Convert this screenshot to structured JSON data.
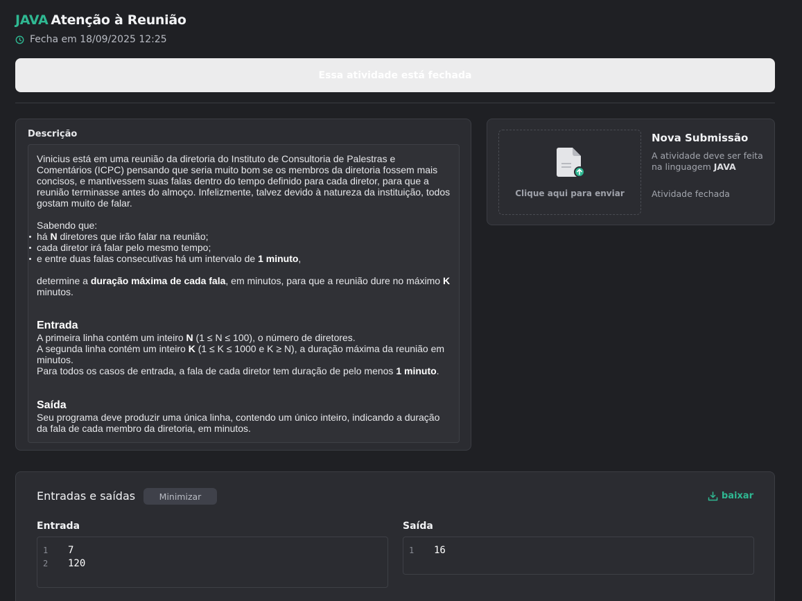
{
  "header": {
    "language": "JAVA",
    "title": "Atenção à Reunião",
    "deadline": "Fecha em 18/09/2025 12:25"
  },
  "closed_banner": "Essa atividade está fechada",
  "description": {
    "label": "Descrição",
    "intro": "Vinicius está em uma reunião da diretoria do Instituto de Consultoria de Palestras e Comentários (ICPC) pensando que seria muito bom se os membros da diretoria fossem mais concisos, e mantivessem suas falas dentro do tempo definido para cada diretor, para que a reunião terminasse antes do almoço. Infelizmente, talvez devido à natureza da instituição, todos gostam muito de falar.",
    "knowing": "Sabendo que:",
    "b1_pre": "há ",
    "b1_bold": "N",
    "b1_post": " diretores que irão falar na reunião;",
    "b2": "cada diretor irá falar pelo mesmo tempo;",
    "b3_pre": "e entre duas falas consecutivas há um intervalo de ",
    "b3_bold": "1 minuto",
    "b3_post": ",",
    "det_pre": "determine a ",
    "det_bold": "duração máxima de cada fala",
    "det_mid": ", em minutos, para que a reunião dure no máximo ",
    "det_bold2": "K",
    "det_post": " minutos.",
    "input_heading": "Entrada",
    "in1_pre": "A primeira linha contém um inteiro ",
    "in1_bold": "N",
    "in1_post": " (1 ≤ N ≤ 100), o número de diretores.",
    "in2_pre": "A segunda linha contém um inteiro ",
    "in2_bold": "K",
    "in2_post": " (1 ≤ K ≤ 1000 e K ≥ N), a duração máxima da reunião em minutos.",
    "in3_pre": "Para todos os casos de entrada, a fala de cada diretor tem duração de pelo menos ",
    "in3_bold": "1 minuto",
    "in3_post": ".",
    "output_heading": "Saída",
    "out1": "Seu programa deve produzir uma única linha, contendo um único inteiro, indicando a duração da fala de cada membro da diretoria, em minutos."
  },
  "submission": {
    "upload_label": "Clique aqui para enviar",
    "title": "Nova Submissão",
    "desc_pre": "A atividade deve ser feita na linguagem ",
    "desc_lang": "JAVA",
    "status": "Atividade fechada"
  },
  "io": {
    "title": "Entradas e saídas",
    "minimize_label": "Minimizar",
    "download_label": "baixar",
    "input_label": "Entrada",
    "output_label": "Saída",
    "input_lines": [
      {
        "n": "1",
        "v": "7"
      },
      {
        "n": "2",
        "v": "120"
      }
    ],
    "output_lines": [
      {
        "n": "1",
        "v": "16"
      }
    ]
  },
  "colors": {
    "accent": "#2fb892",
    "background": "#1f2024",
    "panel": "#2b2c31"
  },
  "icons": [
    "clock-icon",
    "file-upload-icon",
    "download-icon"
  ]
}
